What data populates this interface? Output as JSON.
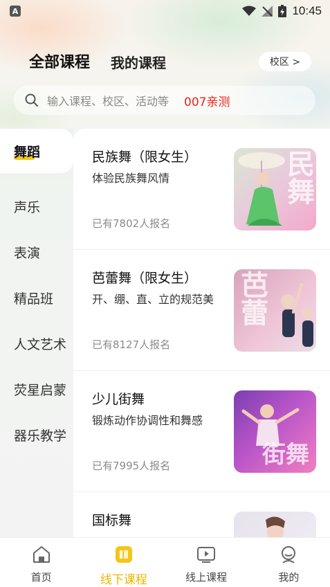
{
  "status_bar": {
    "app_badge": "A",
    "time": "10:45"
  },
  "header": {
    "tab_all": "全部课程",
    "tab_mine": "我的课程",
    "campus_button": "校区 >"
  },
  "search": {
    "placeholder": "输入课程、校区、活动等",
    "tag": "007亲测"
  },
  "categories": [
    {
      "label": "舞蹈",
      "active": true
    },
    {
      "label": "声乐",
      "active": false
    },
    {
      "label": "表演",
      "active": false
    },
    {
      "label": "精品班",
      "active": false
    },
    {
      "label": "人文艺术",
      "active": false
    },
    {
      "label": "荧星启蒙",
      "active": false
    },
    {
      "label": "器乐教学",
      "active": false
    }
  ],
  "courses": [
    {
      "title": "民族舞（限女生）",
      "desc": "体验民族舞风情",
      "count": "已有7802人报名",
      "thumb_text": "民舞",
      "thumb_colors": [
        "#e9c9dc",
        "#f3a9c9"
      ]
    },
    {
      "title": "芭蕾舞（限女生）",
      "desc": "开、绷、直、立的规范美",
      "count": "已有8127人报名",
      "thumb_text": "芭蕾",
      "thumb_colors": [
        "#d8a3bd",
        "#f0c7d8"
      ]
    },
    {
      "title": "少儿街舞",
      "desc": "锻炼动作协调性和舞感",
      "count": "已有7995人报名",
      "thumb_text": "街舞",
      "thumb_colors": [
        "#b955c9",
        "#f07fc0"
      ]
    },
    {
      "title": "国标舞",
      "desc": "",
      "count": "",
      "thumb_text": "",
      "thumb_colors": [
        "#e6e3ee",
        "#f3eef5"
      ]
    }
  ],
  "bottom_nav": [
    {
      "label": "首页",
      "icon": "home-icon",
      "active": false
    },
    {
      "label": "线下课程",
      "icon": "offline-course-icon",
      "active": true
    },
    {
      "label": "线上课程",
      "icon": "online-course-icon",
      "active": false
    },
    {
      "label": "我的",
      "icon": "profile-icon",
      "active": false
    }
  ],
  "colors": {
    "accent": "#f5c518",
    "active_nav": "#f0b400",
    "search_tag": "#e8231c"
  }
}
